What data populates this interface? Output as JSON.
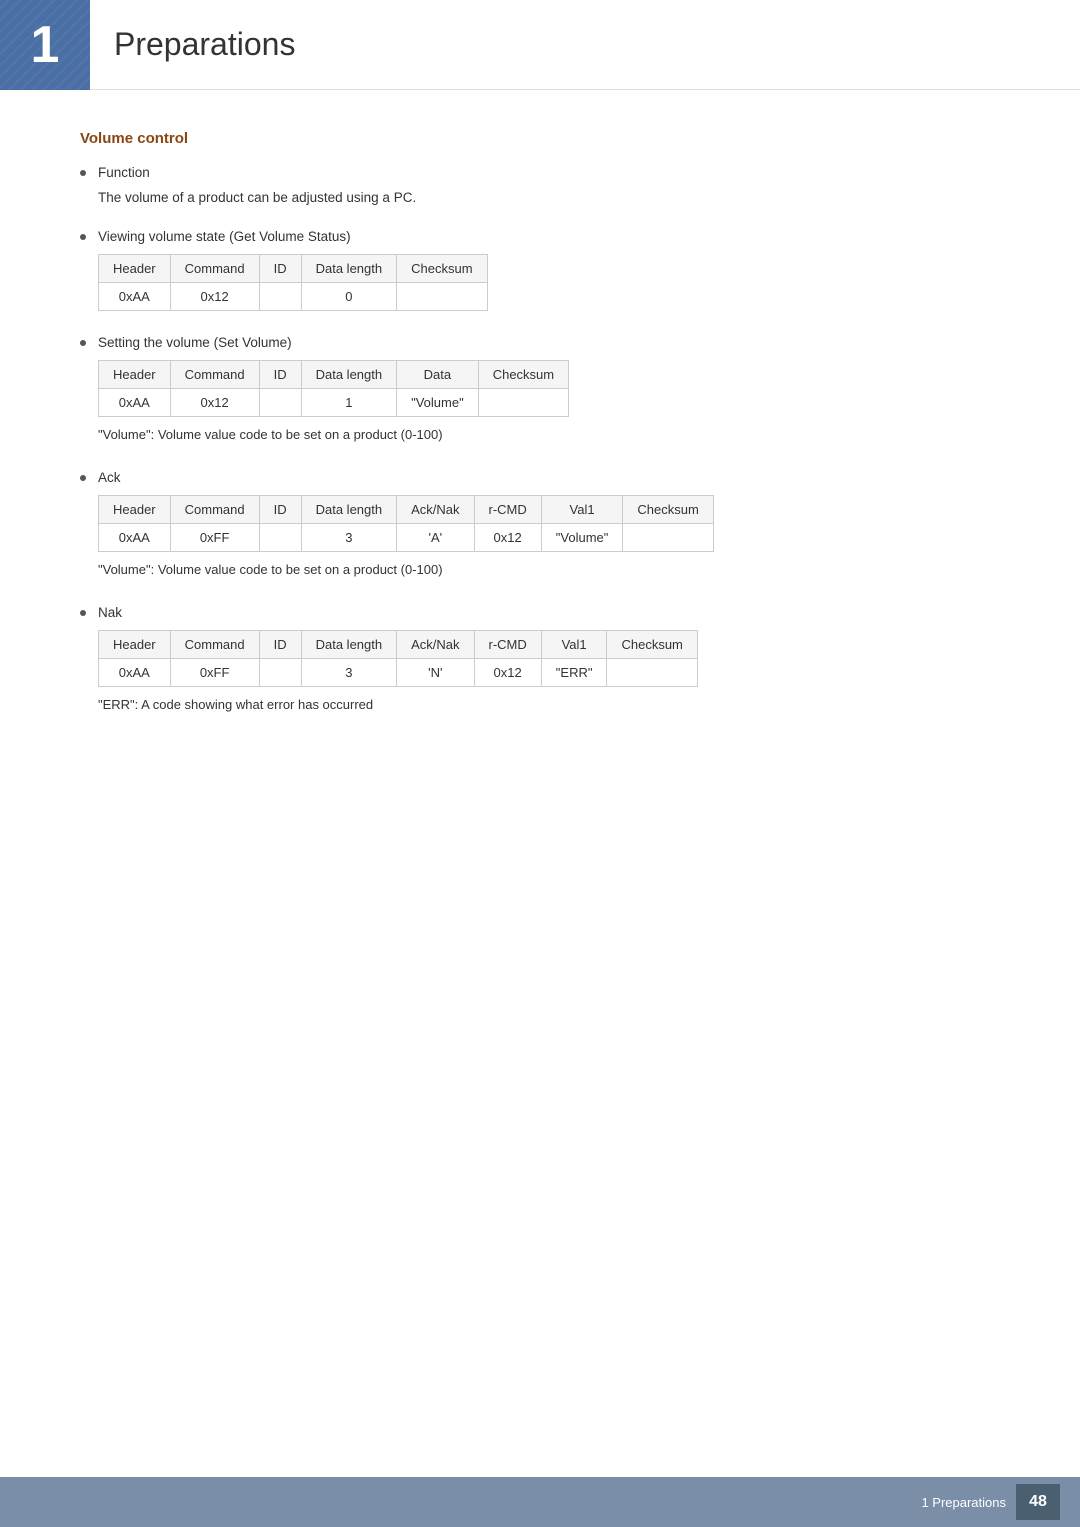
{
  "header": {
    "chapter_number": "1",
    "chapter_title": "Preparations",
    "stripe_present": true
  },
  "section": {
    "title": "Volume control",
    "bullets": [
      {
        "id": "function",
        "label": "Function",
        "sub_text": "The volume of a product can be adjusted using a PC.",
        "has_table": false
      },
      {
        "id": "viewing",
        "label": "Viewing volume state (Get Volume Status)",
        "has_table": true,
        "table_type": "viewing",
        "note": null
      },
      {
        "id": "setting",
        "label": "Setting the volume (Set Volume)",
        "has_table": true,
        "table_type": "setting",
        "note": "\"Volume\": Volume value code to be set on a product (0-100)"
      },
      {
        "id": "ack",
        "label": "Ack",
        "has_table": true,
        "table_type": "ack",
        "note": "\"Volume\": Volume value code to be set on a product (0-100)"
      },
      {
        "id": "nak",
        "label": "Nak",
        "has_table": true,
        "table_type": "nak",
        "note": "\"ERR\": A code showing what error has occurred"
      }
    ],
    "tables": {
      "viewing": {
        "headers": [
          "Header",
          "Command",
          "ID",
          "Data length",
          "Checksum"
        ],
        "rows": [
          [
            "0xAA",
            "0x12",
            "",
            "0",
            ""
          ]
        ]
      },
      "setting": {
        "headers": [
          "Header",
          "Command",
          "ID",
          "Data length",
          "Data",
          "Checksum"
        ],
        "rows": [
          [
            "0xAA",
            "0x12",
            "",
            "1",
            "\"Volume\"",
            ""
          ]
        ]
      },
      "ack": {
        "headers": [
          "Header",
          "Command",
          "ID",
          "Data length",
          "Ack/Nak",
          "r-CMD",
          "Val1",
          "Checksum"
        ],
        "rows": [
          [
            "0xAA",
            "0xFF",
            "",
            "3",
            "‘A’",
            "0x12",
            "\"Volume\"",
            ""
          ]
        ]
      },
      "nak": {
        "headers": [
          "Header",
          "Command",
          "ID",
          "Data length",
          "Ack/Nak",
          "r-CMD",
          "Val1",
          "Checksum"
        ],
        "rows": [
          [
            "0xAA",
            "0xFF",
            "",
            "3",
            "‘N’",
            "0x12",
            "\"ERR\"",
            ""
          ]
        ]
      }
    }
  },
  "footer": {
    "text": "1 Preparations",
    "page": "48"
  }
}
